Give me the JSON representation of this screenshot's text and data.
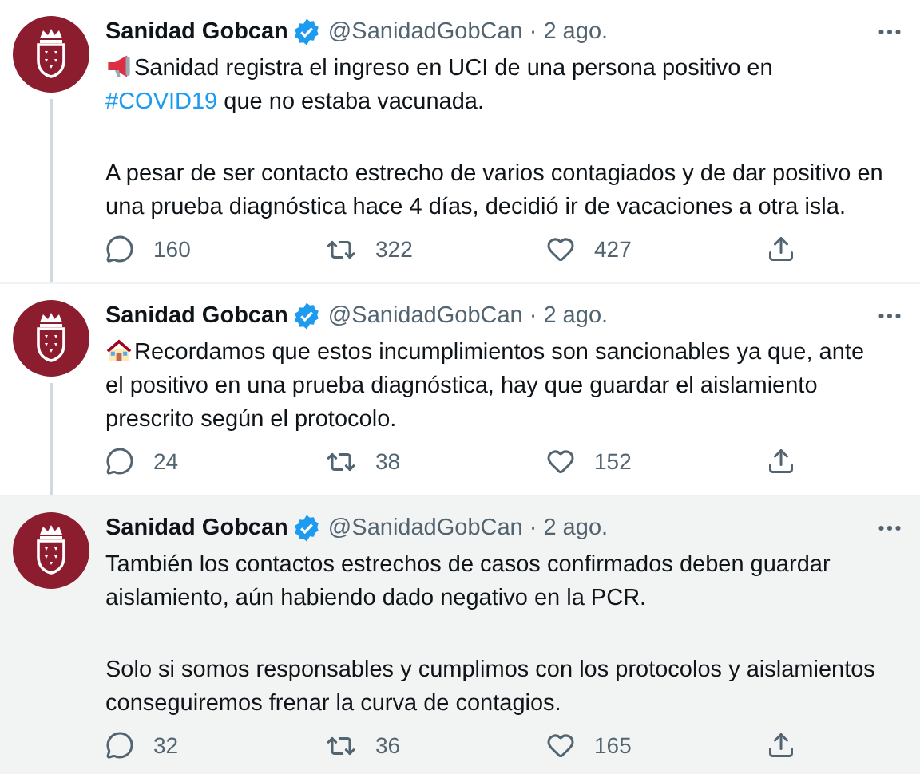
{
  "tweets": [
    {
      "name": "Sanidad Gobcan",
      "verified": true,
      "handle": "@SanidadGobCan",
      "separator": "·",
      "time": "2 ago.",
      "thread_line": true,
      "hovered": false,
      "paragraphs": [
        {
          "kind": "megaphone",
          "segments": [
            {
              "kind": "plain",
              "text": "Sanidad registra el ingreso en UCI de una persona positivo en "
            },
            {
              "kind": "hashtag",
              "text": "#COVID19"
            },
            {
              "kind": "plain",
              "text": " que no estaba vacunada."
            }
          ]
        },
        {
          "kind": "plain",
          "segments": [
            {
              "kind": "plain",
              "text": "A pesar de ser contacto estrecho de varios contagiados y de dar positivo en una prueba diagnóstica hace 4 días, decidió ir de vacaciones a otra isla."
            }
          ]
        }
      ],
      "stats": {
        "replies": "160",
        "retweets": "322",
        "likes": "427"
      }
    },
    {
      "name": "Sanidad Gobcan",
      "verified": true,
      "handle": "@SanidadGobCan",
      "separator": "·",
      "time": "2 ago.",
      "thread_line": true,
      "hovered": false,
      "paragraphs": [
        {
          "kind": "house",
          "segments": [
            {
              "kind": "plain",
              "text": "Recordamos que estos incumplimientos son sancionables ya que, ante el positivo en una prueba diagnóstica, hay que guardar el aislamiento prescrito según el protocolo."
            }
          ]
        }
      ],
      "stats": {
        "replies": "24",
        "retweets": "38",
        "likes": "152"
      }
    },
    {
      "name": "Sanidad Gobcan",
      "verified": true,
      "handle": "@SanidadGobCan",
      "separator": "·",
      "time": "2 ago.",
      "thread_line": false,
      "hovered": true,
      "paragraphs": [
        {
          "kind": "plain",
          "segments": [
            {
              "kind": "plain",
              "text": "También los contactos estrechos de casos confirmados deben guardar aislamiento, aún habiendo dado negativo en la PCR."
            }
          ]
        },
        {
          "kind": "plain",
          "segments": [
            {
              "kind": "plain",
              "text": "Solo si somos responsables y cumplimos con los protocolos y aislamientos conseguiremos frenar la curva de contagios."
            }
          ]
        }
      ],
      "stats": {
        "replies": "32",
        "retweets": "36",
        "likes": "165"
      }
    }
  ]
}
